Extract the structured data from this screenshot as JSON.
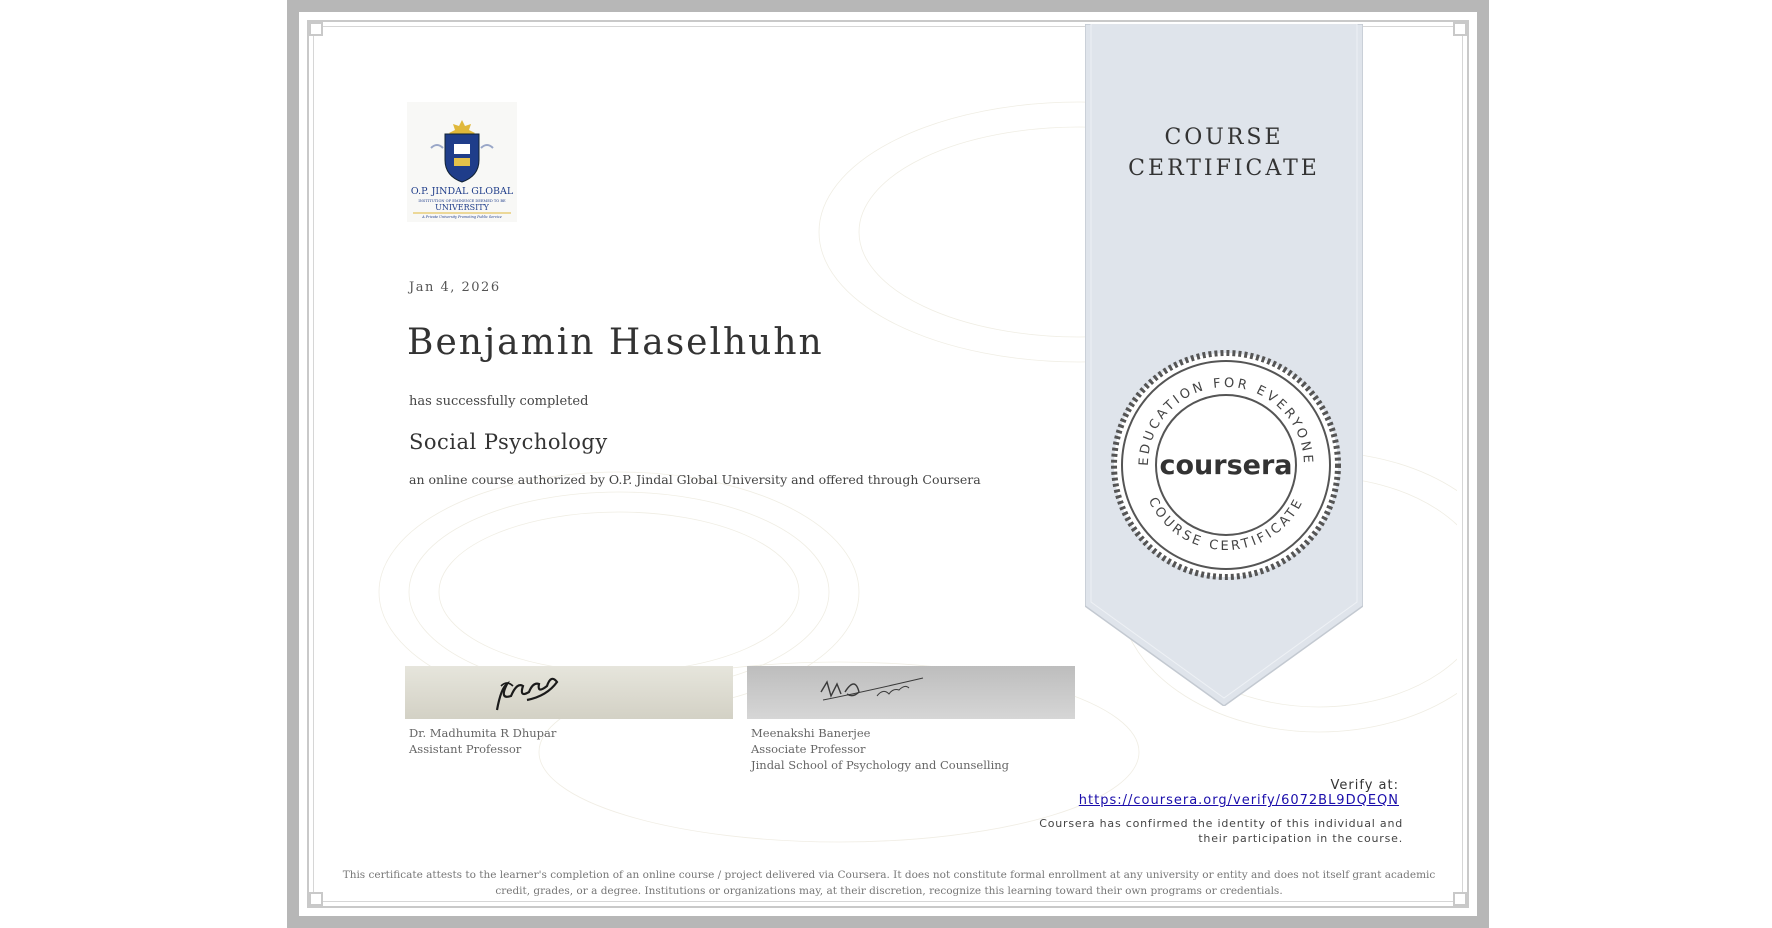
{
  "certificate": {
    "date": "Jan 4, 2026",
    "recipient_name": "Benjamin Haselhuhn",
    "completion_phrase": "has successfully completed",
    "course_title": "Social Psychology",
    "authorization": "an online course authorized by O.P. Jindal Global University and offered through Coursera",
    "type_line1": "COURSE",
    "type_line2": "CERTIFICATE"
  },
  "university_logo": {
    "line1": "O.P. JINDAL GLOBAL",
    "line2": "INSTITUTION OF EMINENCE DEEMED TO BE",
    "line3": "UNIVERSITY",
    "line4": "A Private University Promoting Public Service"
  },
  "signatories": [
    {
      "name": "Dr. Madhumita R Dhupar",
      "title": "Assistant Professor",
      "dept": ""
    },
    {
      "name": "Meenakshi Banerjee",
      "title": "Associate Professor",
      "dept": "Jindal School of Psychology and Counselling"
    }
  ],
  "seal": {
    "brand": "coursera",
    "ring_top": "EDUCATION FOR EVERYONE",
    "ring_bottom": "COURSE CERTIFICATE"
  },
  "verify": {
    "label": "Verify at:",
    "url": "https://coursera.org/verify/6072BL9DQEQN",
    "confirmation": "Coursera has confirmed the identity of this individual and their participation in the course."
  },
  "disclaimer": "This certificate attests to the learner's completion of an online course / project delivered via Coursera. It does not constitute formal enrollment at any university or entity and does not itself grant academic credit, grades, or a degree. Institutions or organizations may, at their discretion, recognize this learning toward their own programs or credentials.",
  "colors": {
    "ribbon": "#dde3ea",
    "frame": "#b7b7b7",
    "link": "#1a0dab",
    "seal_dark": "#444444"
  }
}
